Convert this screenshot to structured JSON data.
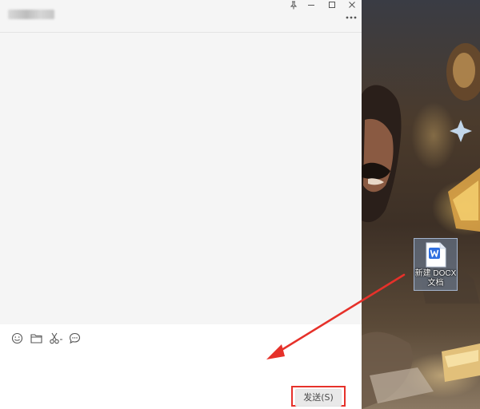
{
  "chat": {
    "contact_name": "",
    "toolbar": {
      "emoji": "emoji-icon",
      "file": "folder-icon",
      "screenshot": "scissors-icon",
      "history": "chat-bubble-icon"
    },
    "message_input": "",
    "send_label": "发送(S)"
  },
  "desktop": {
    "file_icon": {
      "label_line1": "新建 DOCX",
      "label_line2": "文档",
      "icon": "word-document-icon"
    }
  },
  "colors": {
    "chat_background": "#f5f5f5",
    "input_background": "#ffffff",
    "send_button": "#e9e9e9",
    "annotation_red": "#e6312a",
    "word_blue": "#2f6fe0"
  }
}
